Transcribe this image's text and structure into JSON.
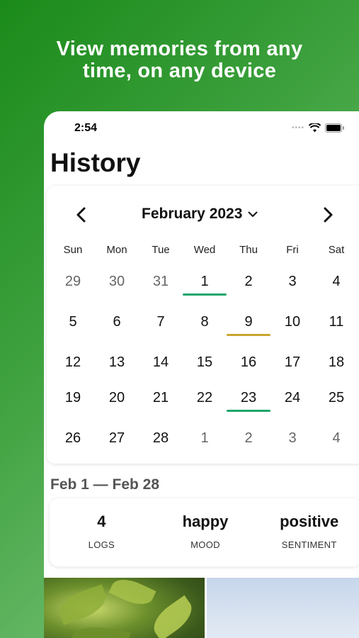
{
  "promo": {
    "line1": "View memories from any",
    "line2": "time, on any device"
  },
  "status_bar": {
    "time": "2:54"
  },
  "page": {
    "title": "History"
  },
  "calendar": {
    "month_label": "February 2023",
    "weekdays": [
      "Sun",
      "Mon",
      "Tue",
      "Wed",
      "Thu",
      "Fri",
      "Sat"
    ],
    "days": [
      {
        "d": "29",
        "other": true
      },
      {
        "d": "30",
        "other": true
      },
      {
        "d": "31",
        "other": true
      },
      {
        "d": "1",
        "mark": "#1aa66a"
      },
      {
        "d": "2"
      },
      {
        "d": "3"
      },
      {
        "d": "4"
      },
      {
        "d": "5"
      },
      {
        "d": "6"
      },
      {
        "d": "7"
      },
      {
        "d": "8"
      },
      {
        "d": "9",
        "mark": "#c9a52e"
      },
      {
        "d": "10"
      },
      {
        "d": "11"
      },
      {
        "d": "12"
      },
      {
        "d": "13"
      },
      {
        "d": "14"
      },
      {
        "d": "15"
      },
      {
        "d": "16"
      },
      {
        "d": "17"
      },
      {
        "d": "18"
      },
      {
        "d": "19"
      },
      {
        "d": "20"
      },
      {
        "d": "21"
      },
      {
        "d": "22"
      },
      {
        "d": "23",
        "mark": "#1aa66a"
      },
      {
        "d": "24"
      },
      {
        "d": "25"
      },
      {
        "d": "26"
      },
      {
        "d": "27"
      },
      {
        "d": "28"
      },
      {
        "d": "1",
        "other": true
      },
      {
        "d": "2",
        "other": true
      },
      {
        "d": "3",
        "other": true
      },
      {
        "d": "4",
        "other": true
      }
    ]
  },
  "summary": {
    "range_title": "Feb 1 — Feb 28",
    "stats": [
      {
        "value": "4",
        "label": "LOGS"
      },
      {
        "value": "happy",
        "label": "MOOD"
      },
      {
        "value": "positive",
        "label": "SENTIMENT"
      }
    ]
  },
  "colors": {
    "accent_green": "#1aa66a",
    "accent_gold": "#c9a52e"
  },
  "icons": {
    "prev": "chevron-left-icon",
    "next": "chevron-right-icon",
    "month_dropdown": "chevron-down-icon",
    "wifi": "wifi-icon",
    "battery": "battery-icon",
    "cellular": "signal-dots-icon"
  }
}
